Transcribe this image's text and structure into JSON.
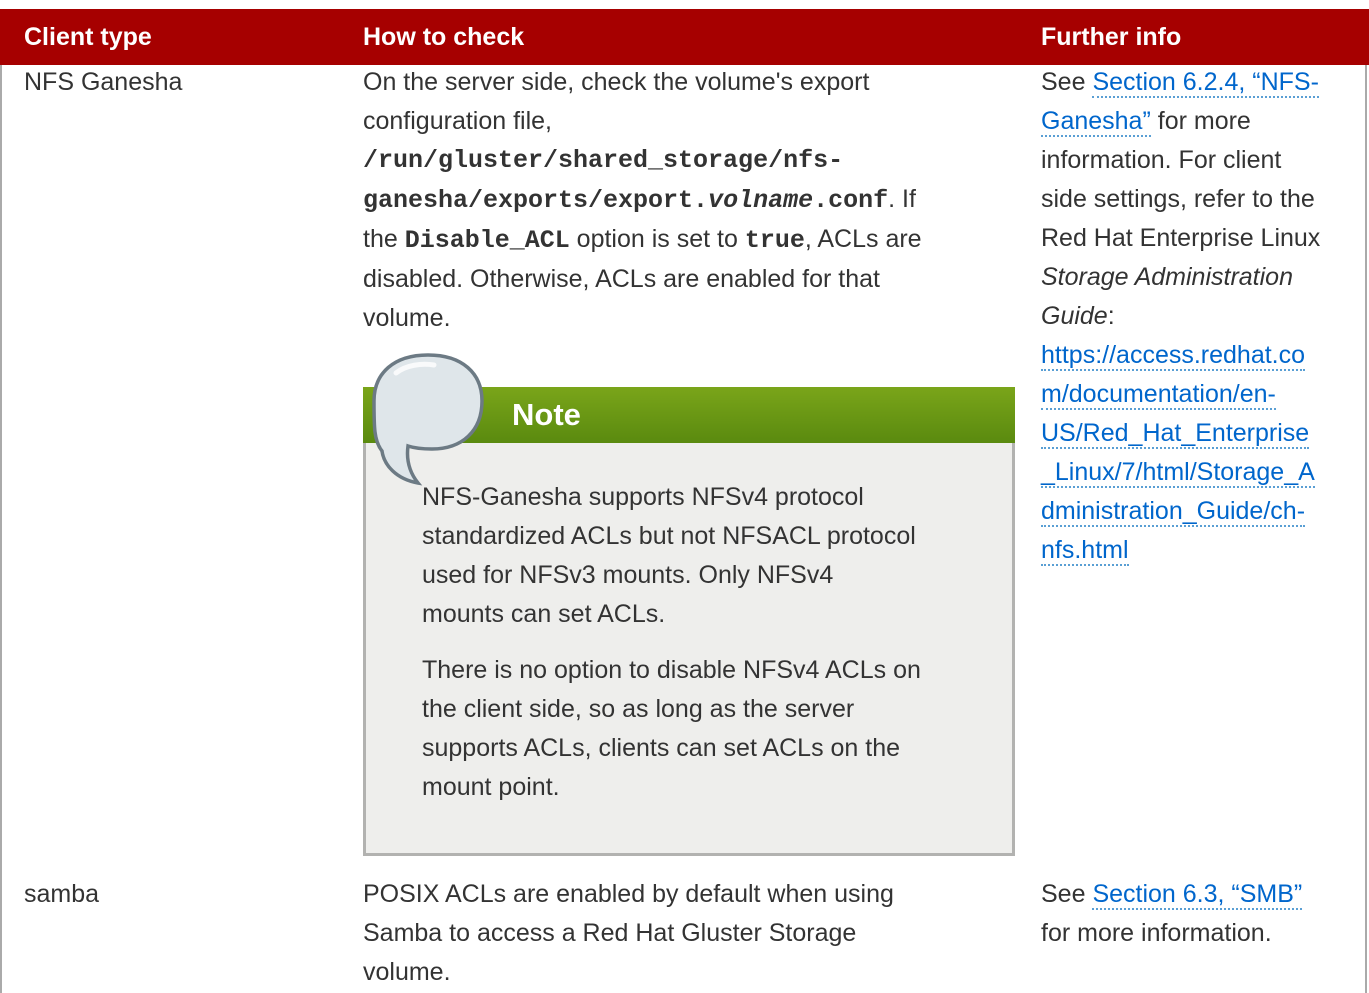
{
  "header": {
    "col1": "Client type",
    "col2": "How to check",
    "col3": "Further info"
  },
  "row1": {
    "client": "NFS Ganesha",
    "check": {
      "line1": "On the server side, check the volume's export",
      "line2": "configuration file,",
      "path1": "/run/gluster/shared_storage/nfs-",
      "path2a": "ganesha/exports/export.",
      "path2b": "volname",
      "path2c": ".conf",
      "path2d": ". If",
      "l4a": "the ",
      "l4b": "Disable_ACL",
      "l4c": " option is set to ",
      "l4d": "true",
      "l4e": ", ACLs are",
      "line5": "disabled. Otherwise, ACLs are enabled for that",
      "line6": "volume."
    },
    "note": {
      "title": "Note",
      "p1": [
        "NFS-Ganesha supports NFSv4 protocol",
        "standardized ACLs but not NFSACL protocol",
        "used for NFSv3 mounts. Only NFSv4",
        "mounts can set ACLs."
      ],
      "p2": [
        "There is no option to disable NFSv4 ACLs on",
        "the client side, so as long as the server",
        "supports ACLs, clients can set ACLs on the",
        "mount point."
      ]
    },
    "info": {
      "see": "See ",
      "link1a": "Section 6.2.4, “NFS-",
      "link1b": "Ganesha”",
      "after": " for more",
      "l3": "information. For client",
      "l4": "side settings, refer to the",
      "l5": "Red Hat Enterprise Linux",
      "l6": "Storage Administration",
      "l7": "Guide",
      "l7b": ":",
      "url": [
        "https://access.redhat.co",
        "m/documentation/en-",
        "US/Red_Hat_Enterprise",
        "_Linux/7/html/Storage_A",
        "dministration_Guide/ch-",
        "nfs.html"
      ]
    }
  },
  "row2": {
    "client": "samba",
    "check": [
      "POSIX ACLs are enabled by default when using",
      "Samba to access a Red Hat Gluster Storage",
      "volume."
    ],
    "info": {
      "see": "See ",
      "link": "Section 6.3, “SMB”",
      "l2": "for more information."
    }
  },
  "colors": {
    "header_bg": "#a60000",
    "note_bar": "#6a9a14",
    "link": "#0066cc"
  }
}
